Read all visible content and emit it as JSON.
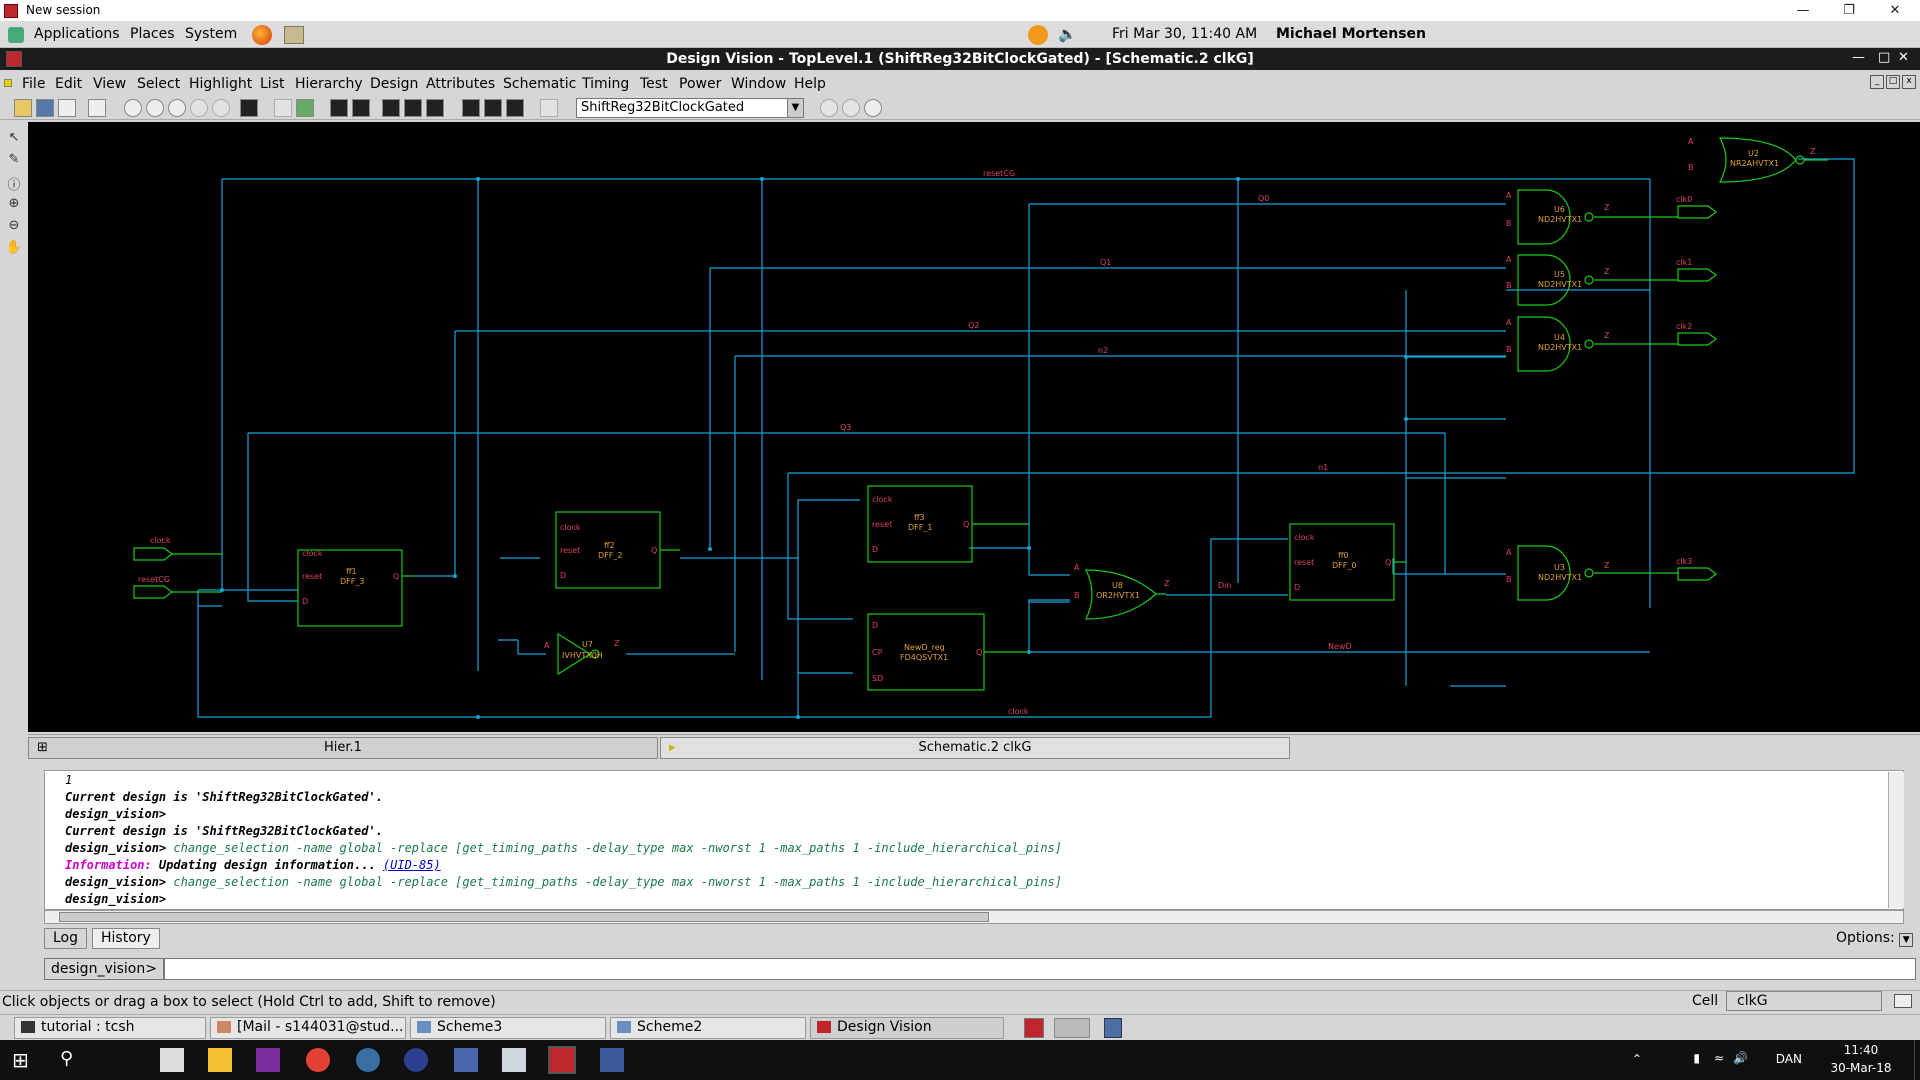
{
  "window": {
    "title": "New session"
  },
  "gnome_panel": {
    "menus": [
      "Applications",
      "Places",
      "System"
    ],
    "datetime": "Fri Mar 30, 11:40 AM",
    "user": "Michael Mortensen"
  },
  "app": {
    "title": "Design Vision - TopLevel.1 (ShiftReg32BitClockGated) - [Schematic.2   clkG]"
  },
  "menubar": [
    "File",
    "Edit",
    "View",
    "Select",
    "Highlight",
    "List",
    "Hierarchy",
    "Design",
    "Attributes",
    "Schematic",
    "Timing",
    "Test",
    "Power",
    "Window",
    "Help"
  ],
  "toolbar": {
    "design_select": "ShiftReg32BitClockGated"
  },
  "schematic": {
    "nets": [
      "resetCG",
      "Q0",
      "Q1",
      "Q2",
      "n2",
      "Q3",
      "n1",
      "Din",
      "NewD",
      "clock"
    ],
    "ports_in": [
      "clock",
      "resetCG"
    ],
    "ports_out": [
      "clk0",
      "clk1",
      "clk2",
      "clk3"
    ],
    "cells": [
      {
        "inst": "ff1",
        "type": "DFF_3",
        "pins": [
          "clock",
          "reset",
          "D",
          "Q"
        ]
      },
      {
        "inst": "ff2",
        "type": "DFF_2",
        "pins": [
          "clock",
          "reset",
          "D",
          "Q"
        ]
      },
      {
        "inst": "ff3",
        "type": "DFF_1",
        "pins": [
          "clock",
          "reset",
          "D",
          "Q"
        ]
      },
      {
        "inst": "ff0",
        "type": "DFF_0",
        "pins": [
          "clock",
          "reset",
          "D",
          "Q"
        ]
      },
      {
        "inst": "NewD_reg",
        "type": "FD4QSVTX1",
        "pins": [
          "D",
          "CP",
          "SD",
          "Q"
        ]
      },
      {
        "inst": "U7",
        "type": "IVHVTX0H",
        "pins": [
          "A",
          "Z"
        ]
      },
      {
        "inst": "U8",
        "type": "OR2HVTX1",
        "pins": [
          "A",
          "B",
          "Z"
        ]
      },
      {
        "inst": "U2",
        "type": "NR2AHVTX1",
        "pins": [
          "A",
          "B",
          "Z"
        ]
      },
      {
        "inst": "U6",
        "type": "ND2HVTX1",
        "pins": [
          "A",
          "B",
          "Z"
        ]
      },
      {
        "inst": "U5",
        "type": "ND2HVTX1",
        "pins": [
          "A",
          "B",
          "Z"
        ]
      },
      {
        "inst": "U4",
        "type": "ND2HVTX1",
        "pins": [
          "A",
          "B",
          "Z"
        ]
      },
      {
        "inst": "U3",
        "type": "ND2HVTX1",
        "pins": [
          "A",
          "B",
          "Z"
        ]
      }
    ],
    "colors": {
      "background": "#000000",
      "wire": "#1aa3d9",
      "cell": "#19c919",
      "label": "#e0a030",
      "net_label": "#e04060"
    }
  },
  "view_tabs": [
    "Hier.1",
    "Schematic.2   clkG"
  ],
  "console": {
    "lines": [
      {
        "prompt": "",
        "text": "1",
        "kind": "plain"
      },
      {
        "prompt": "",
        "text": "Current design is 'ShiftReg32BitClockGated'.",
        "kind": "plain"
      },
      {
        "prompt": "design_vision>",
        "text": "",
        "kind": "plain"
      },
      {
        "prompt": "",
        "text": "Current design is 'ShiftReg32BitClockGated'.",
        "kind": "plain"
      },
      {
        "prompt": "design_vision>",
        "text": " change_selection -name global -replace [get_timing_paths -delay_type max -nworst 1 -max_paths 1 -include_hierarchical_pins]",
        "kind": "cmd"
      },
      {
        "prompt": "Information:",
        "text": " Updating design information... ",
        "link": "(UID-85)",
        "kind": "info"
      },
      {
        "prompt": "design_vision>",
        "text": " change_selection -name global -replace [get_timing_paths -delay_type max -nworst 1 -max_paths 1 -include_hierarchical_pins]",
        "kind": "cmd"
      },
      {
        "prompt": "design_vision>",
        "text": "",
        "kind": "plain"
      }
    ]
  },
  "log_tabs": [
    "Log",
    "History"
  ],
  "options_label": "Options:",
  "prompt": {
    "label": "design_vision>",
    "value": ""
  },
  "status": {
    "text": "Click objects or drag a box to select (Hold Ctrl to add, Shift to remove)",
    "cell_label": "Cell",
    "cell_value": "clkG"
  },
  "taskbar": [
    "tutorial : tcsh",
    "[Mail - s144031@stud...",
    "Scheme3",
    "Scheme2",
    "Design Vision"
  ],
  "win_tray": {
    "lang": "DAN",
    "time": "11:40",
    "date": "30-Mar-18"
  }
}
